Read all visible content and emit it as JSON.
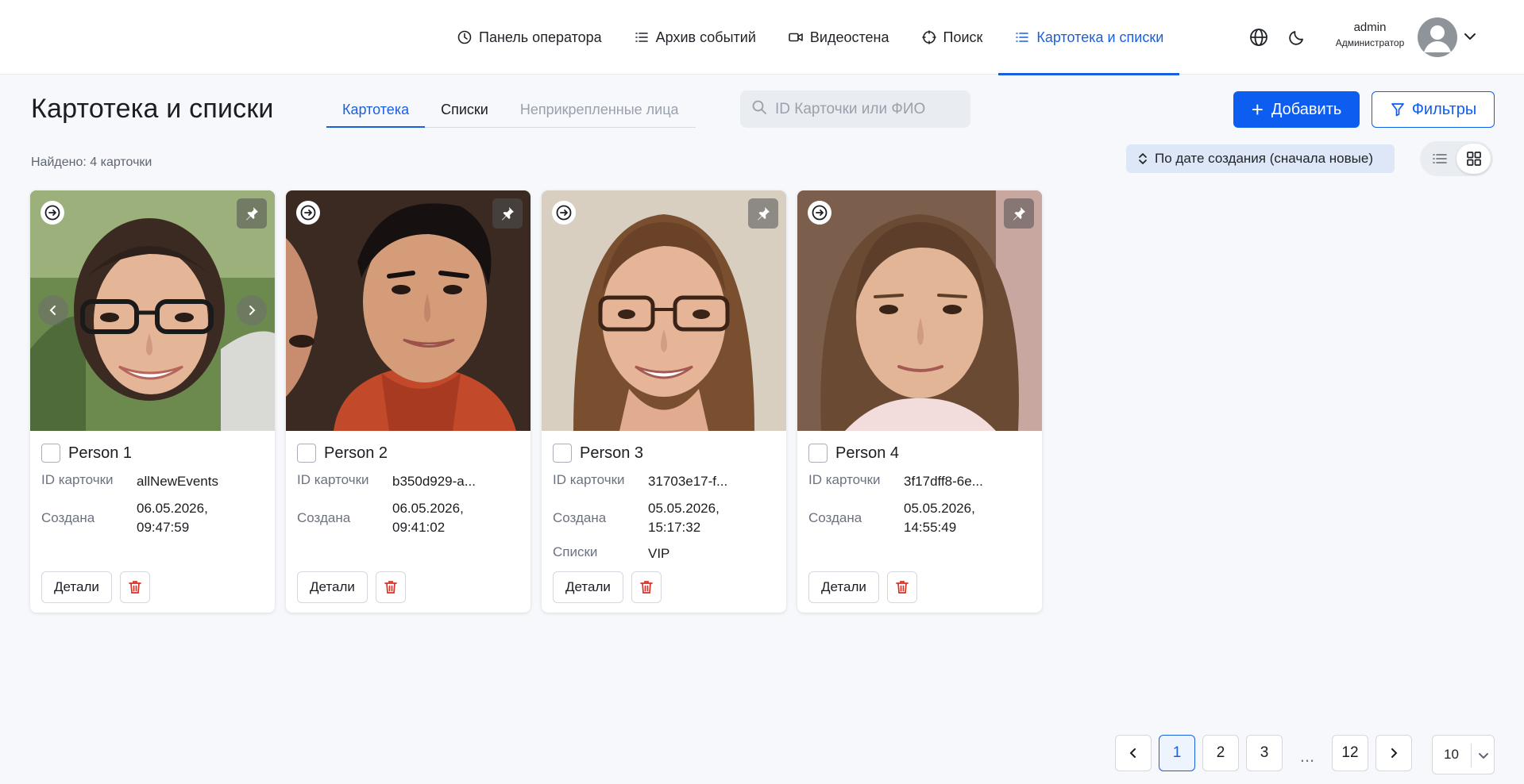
{
  "nav": {
    "items": [
      {
        "label": "Панель оператора",
        "icon": "clock-icon"
      },
      {
        "label": "Архив событий",
        "icon": "list-icon"
      },
      {
        "label": "Видеостена",
        "icon": "video-camera-icon"
      },
      {
        "label": "Поиск",
        "icon": "crosshair-icon"
      },
      {
        "label": "Картотека и списки",
        "icon": "list-icon",
        "active": true
      }
    ],
    "user": {
      "name": "admin",
      "role": "Администратор"
    }
  },
  "page": {
    "title": "Картотека и списки",
    "tabs": [
      {
        "label": "Картотека",
        "state": "active"
      },
      {
        "label": "Списки",
        "state": "normal"
      },
      {
        "label": "Неприкрепленные лица",
        "state": "muted"
      }
    ],
    "search_placeholder": "ID Карточки или ФИО",
    "add_label": "Добавить",
    "filters_label": "Фильтры",
    "found": "Найдено: 4 карточки",
    "sort_label": "По дате создания (сначала новые)"
  },
  "labels": {
    "card_id": "ID карточки",
    "created": "Создана",
    "lists": "Списки",
    "details": "Детали"
  },
  "cards": [
    {
      "name": "Person 1",
      "id": "allNewEvents",
      "created_date": "06.05.2026,",
      "created_time": "09:47:59",
      "lists": ""
    },
    {
      "name": "Person 2",
      "id": "b350d929-a...",
      "created_date": "06.05.2026,",
      "created_time": "09:41:02",
      "lists": ""
    },
    {
      "name": "Person 3",
      "id": "31703e17-f...",
      "created_date": "05.05.2026,",
      "created_time": "15:17:32",
      "lists": "VIP"
    },
    {
      "name": "Person 4",
      "id": "3f17dff8-6e...",
      "created_date": "05.05.2026,",
      "created_time": "14:55:49",
      "lists": ""
    }
  ],
  "pagination": {
    "pages": [
      "1",
      "2",
      "3"
    ],
    "dots": "...",
    "last": "12",
    "current": "1",
    "per_page": "10"
  },
  "colors": {
    "accent": "#0d5df0",
    "active_tab": "#1a5fe0",
    "delete": "#d93025"
  }
}
